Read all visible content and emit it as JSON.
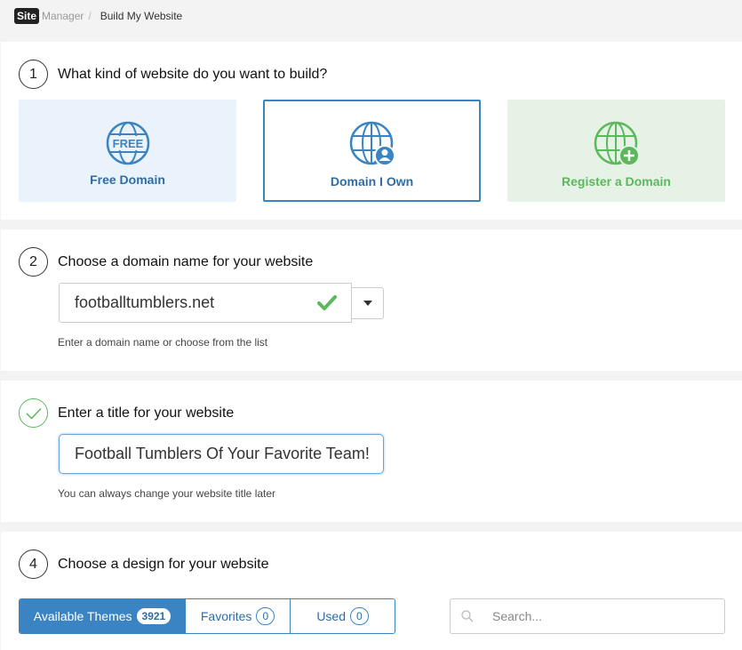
{
  "breadcrumb": {
    "logo_site": "Site",
    "logo_manager": "Manager",
    "separator": "/",
    "current": "Build My Website"
  },
  "step1": {
    "number": "1",
    "title": "What kind of website do you want to build?",
    "options": [
      {
        "label": "Free Domain",
        "icon": "free-globe-icon"
      },
      {
        "label": "Domain I Own",
        "icon": "globe-user-icon"
      },
      {
        "label": "Register a Domain",
        "icon": "globe-plus-icon"
      }
    ]
  },
  "step2": {
    "number": "2",
    "title": "Choose a domain name for your website",
    "domain_value": "footballtumblers.net",
    "hint": "Enter a domain name or choose from the list"
  },
  "step3": {
    "title": "Enter a title for your website",
    "title_value": "Football Tumblers Of Your Favorite Team!",
    "hint": "You can always change your website title later"
  },
  "step4": {
    "number": "4",
    "title": "Choose a design for your website",
    "tabs": [
      {
        "label": "Available Themes",
        "count": "3921"
      },
      {
        "label": "Favorites",
        "count": "0"
      },
      {
        "label": "Used",
        "count": "0"
      }
    ],
    "search_placeholder": "Search..."
  },
  "colors": {
    "primary_blue": "#3a84c4",
    "success_green": "#5cb85c",
    "free_bg": "#eaf2fb",
    "register_bg": "#e6f2e6"
  }
}
